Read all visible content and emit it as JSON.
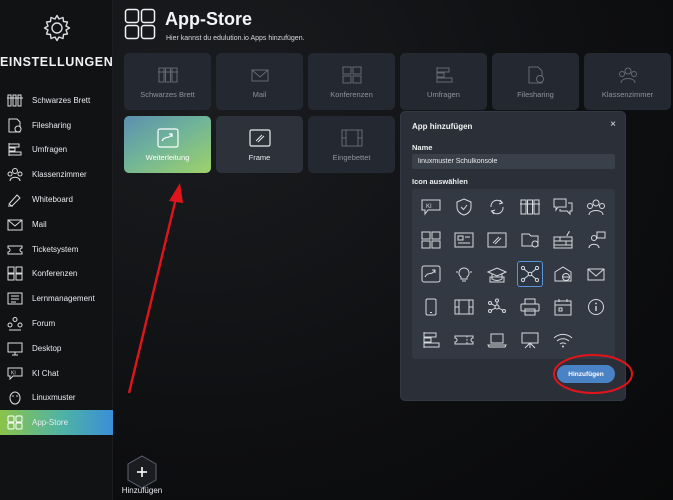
{
  "sidebar": {
    "title": "EINSTELLUNGEN",
    "items": [
      {
        "label": "Schwarzes Brett",
        "icon": "noticeboard-icon"
      },
      {
        "label": "Filesharing",
        "icon": "file-share-icon"
      },
      {
        "label": "Umfragen",
        "icon": "survey-icon"
      },
      {
        "label": "Klassenzimmer",
        "icon": "classroom-icon"
      },
      {
        "label": "Whiteboard",
        "icon": "whiteboard-icon"
      },
      {
        "label": "Mail",
        "icon": "mail-icon"
      },
      {
        "label": "Ticketsystem",
        "icon": "ticket-icon"
      },
      {
        "label": "Konferenzen",
        "icon": "conference-icon"
      },
      {
        "label": "Lernmanagement",
        "icon": "learning-icon"
      },
      {
        "label": "Forum",
        "icon": "forum-icon"
      },
      {
        "label": "Desktop",
        "icon": "desktop-icon"
      },
      {
        "label": "KI Chat",
        "icon": "ai-chat-icon"
      },
      {
        "label": "Linuxmuster",
        "icon": "linuxmuster-icon"
      },
      {
        "label": "App-Store",
        "icon": "app-store-icon",
        "active": true
      }
    ],
    "add_label": "Hinzufügen"
  },
  "header": {
    "title": "App-Store",
    "subtitle": "Hier kannst du edulution.io Apps hinzufügen."
  },
  "tiles_row1": [
    {
      "label": "Schwarzes Brett",
      "icon": "noticeboard-icon"
    },
    {
      "label": "Mail",
      "icon": "mail-icon"
    },
    {
      "label": "Konferenzen",
      "icon": "conference-icon"
    },
    {
      "label": "Umfragen",
      "icon": "survey-icon"
    },
    {
      "label": "Filesharing",
      "icon": "file-share-icon"
    },
    {
      "label": "Klassenzimmer",
      "icon": "classroom-icon"
    }
  ],
  "tiles_row2": [
    {
      "label": "Weiterleitung",
      "icon": "forward-icon",
      "state": "active"
    },
    {
      "label": "Frame",
      "icon": "frame-icon",
      "state": "lit"
    },
    {
      "label": "Eingebettet",
      "icon": "embedded-icon",
      "state": "dim"
    }
  ],
  "dialog": {
    "title": "App hinzufügen",
    "close": "×",
    "name_label": "Name",
    "name_value": "linuxmuster Schulkonsole",
    "icon_label": "Icon auswählen",
    "selected_icon": "network-nodes-icon",
    "submit": "Hinzufügen"
  },
  "colors": {
    "accent_blue": "#4a82c6",
    "active_gradient_start": "#8bc34a",
    "active_gradient_end": "#3a8fd6",
    "annotation_red": "#e0141b"
  }
}
